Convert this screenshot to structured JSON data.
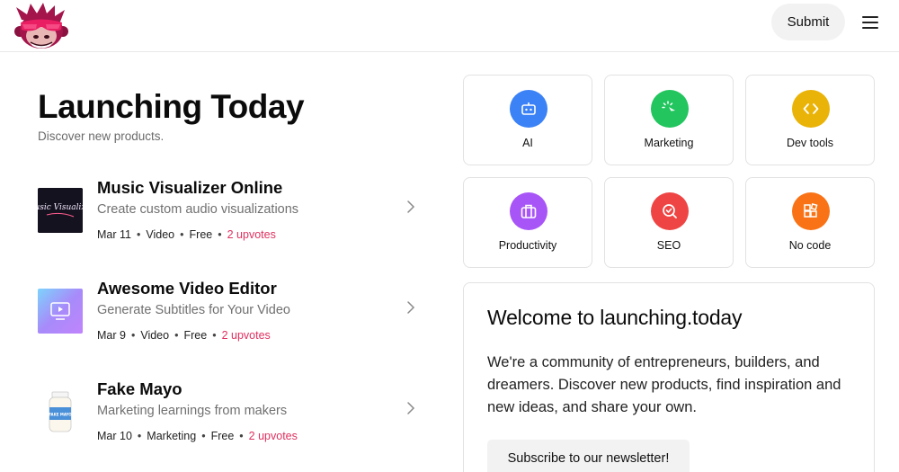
{
  "header": {
    "submit_label": "Submit",
    "logo_icon": "gorilla-mascot-logo",
    "menu_icon": "hamburger-menu-icon"
  },
  "main": {
    "title": "Launching Today",
    "subtitle": "Discover new products."
  },
  "products": [
    {
      "name": "Music Visualizer Online",
      "tagline": "Create custom audio visualizations",
      "date": "Mar 11",
      "category": "Video",
      "pricing": "Free",
      "upvotes": "2 upvotes",
      "thumb_text": "Music Visualizer"
    },
    {
      "name": "Awesome Video Editor",
      "tagline": "Generate Subtitles for Your Video",
      "date": "Mar 9",
      "category": "Video",
      "pricing": "Free",
      "upvotes": "2 upvotes"
    },
    {
      "name": "Fake Mayo",
      "tagline": "Marketing learnings from makers",
      "date": "Mar 10",
      "category": "Marketing",
      "pricing": "Free",
      "upvotes": "2 upvotes",
      "thumb_text": "FAKE MAYO"
    }
  ],
  "categories": [
    {
      "label": "AI",
      "icon": "robot-icon",
      "color": "#3b82f6"
    },
    {
      "label": "Marketing",
      "icon": "cursor-click-icon",
      "color": "#22c55e"
    },
    {
      "label": "Dev tools",
      "icon": "code-icon",
      "color": "#eab308"
    },
    {
      "label": "Productivity",
      "icon": "briefcase-icon",
      "color": "#a855f7"
    },
    {
      "label": "SEO",
      "icon": "search-check-icon",
      "color": "#ef4444"
    },
    {
      "label": "No code",
      "icon": "blocks-icon",
      "color": "#f97316"
    }
  ],
  "welcome": {
    "title": "Welcome to launching.today",
    "body": "We're a community of entrepreneurs, builders, and dreamers. Discover new products, find inspiration and new ideas, and share your own.",
    "newsletter_label": "Subscribe to our newsletter!"
  },
  "colors": {
    "upvote": "#e0305f",
    "border": "#e2e2e2",
    "button_bg": "#f2f2f2"
  }
}
